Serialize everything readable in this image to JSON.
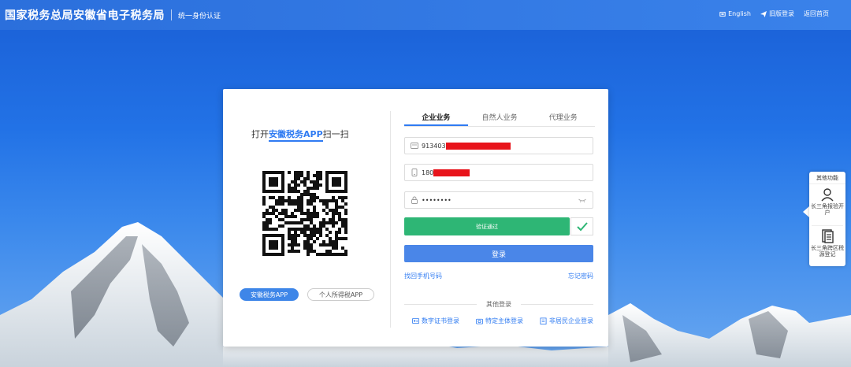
{
  "header": {
    "title": "国家税务总局安徽省电子税务局",
    "subtitle": "统一身份认证",
    "links": [
      {
        "label": "English",
        "icon": "globe-icon"
      },
      {
        "label": "旧版登录",
        "icon": "send-icon"
      },
      {
        "label": "返回首页",
        "icon": ""
      }
    ]
  },
  "scan": {
    "prefix": "打开",
    "app_name": "安徽税务APP",
    "suffix": "扫一扫"
  },
  "app_buttons": {
    "active": "安徽税务APP",
    "other": "个人所得税APP"
  },
  "tabs": [
    "企业业务",
    "自然人业务",
    "代理业务"
  ],
  "active_tab": 0,
  "form": {
    "tax_id_value": "913403",
    "phone_value": "180",
    "password_value": "••••••••",
    "verify_label": "验证通过",
    "login_label": "登录",
    "link_left": "找回手机号码",
    "link_right": "忘记密码"
  },
  "other_login": {
    "title": "其他登录",
    "options": [
      "数字证书登录",
      "特定主体登录",
      "非居民企业登录"
    ]
  },
  "side_panel": {
    "title": "其他功能",
    "items": [
      {
        "label": "长三角报验开户",
        "icon": "person-icon"
      },
      {
        "label": "长三角跨区税源登记",
        "icon": "document-icon"
      }
    ]
  },
  "colors": {
    "header": "#2b6fdc",
    "accent": "#2f7bf2",
    "verify_green": "#2eb675",
    "login_blue": "#4a86e8",
    "redaction": "#e8141b"
  }
}
